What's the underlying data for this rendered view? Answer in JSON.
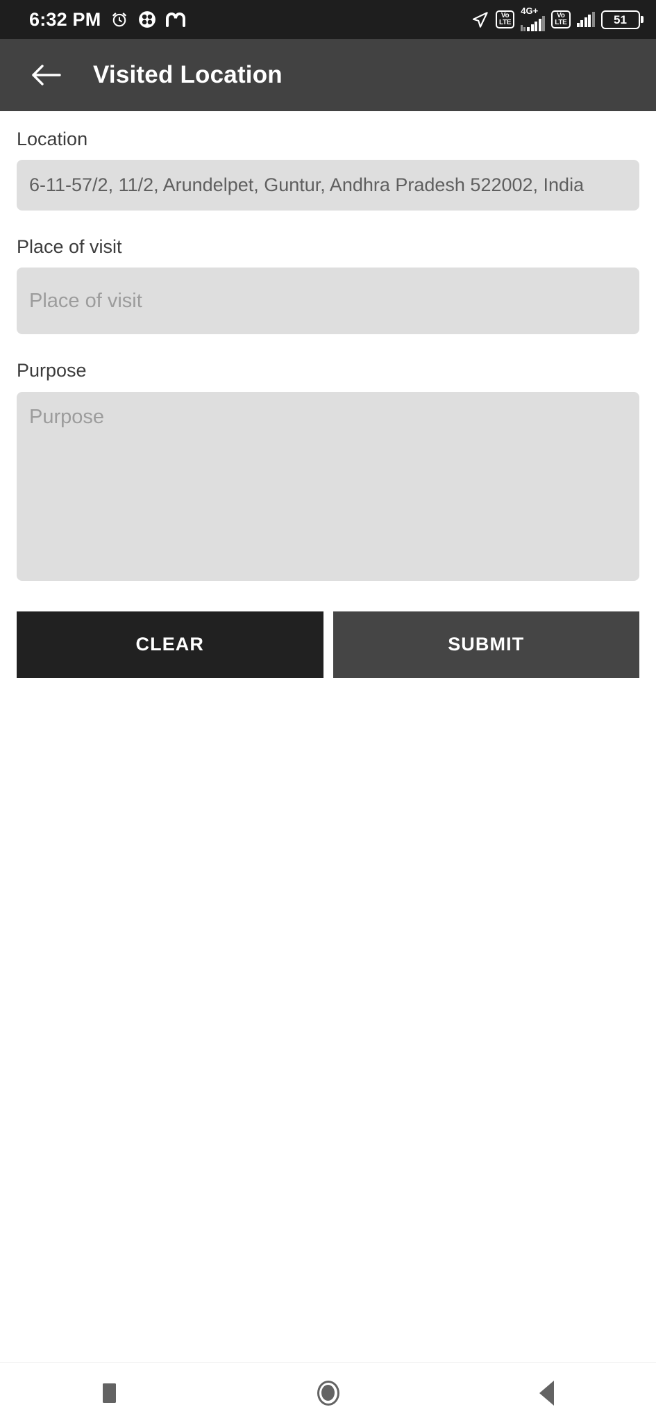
{
  "status_bar": {
    "time": "6:32 PM",
    "alarm_icon": "alarm-clock-icon",
    "clover_icon": "clover-app-icon",
    "m_icon": "m-app-icon",
    "location_icon": "location-arrow-icon",
    "volte_1_top": "Vo",
    "volte_1_bottom": "LTE",
    "network_label": "4G+",
    "volte_2_top": "Vo",
    "volte_2_bottom": "LTE",
    "battery_percent": "51",
    "background_color": "#1e1e1e"
  },
  "app_bar": {
    "back_icon": "back-arrow-icon",
    "title": "Visited Location",
    "background_color": "#424242",
    "text_color": "#ffffff"
  },
  "form": {
    "location": {
      "label": "Location",
      "value": "6-11-57/2, 11/2, Arundelpet, Guntur, Andhra Pradesh 522002, India",
      "readonly": true
    },
    "place_of_visit": {
      "label": "Place of visit",
      "placeholder": "Place of visit",
      "value": ""
    },
    "purpose": {
      "label": "Purpose",
      "placeholder": "Purpose",
      "value": ""
    },
    "field_background_color": "#dedede",
    "placeholder_color": "#9c9c9c"
  },
  "actions": {
    "clear_label": "CLEAR",
    "submit_label": "SUBMIT",
    "clear_color": "#212121",
    "submit_color": "#454545"
  },
  "nav_bar": {
    "recents_icon": "square-recents-icon",
    "home_icon": "circle-home-icon",
    "back_icon": "triangle-back-icon",
    "icon_color": "#636363"
  }
}
